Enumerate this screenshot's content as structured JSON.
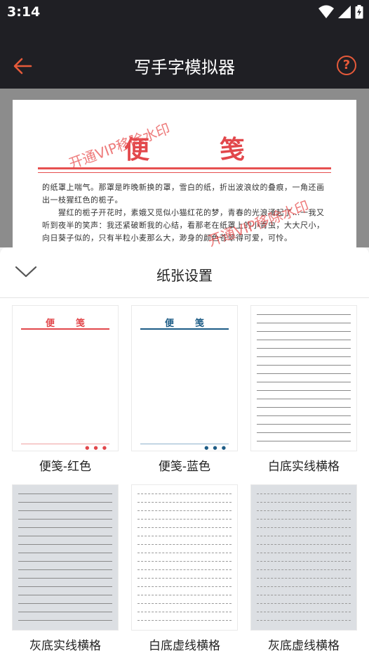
{
  "status": {
    "time": "3:14"
  },
  "app": {
    "title": "写手字模拟器",
    "help_label": "?"
  },
  "preview": {
    "title": "便笺",
    "text": "的纸罩上喘气。那罩是昨晚新换的罩，雪白的纸，折出波浪纹的叠痕，一角还画出一枝猩红色的栀子。\n　　猩红的栀子开花时，素娥又觅似小猫红花的梦，青春的光浪涌起了…一我又听到夜半的笑声：我还紧破断我的心结，看那老在纸罩上的小青虫，大大尺小，向日葵子似的，只有半粒小麦那么大，渺身的颜色苍翠得可爱，可怜。",
    "watermark": "开通VIP移除水印"
  },
  "sheet": {
    "title": "纸张设置"
  },
  "papers": [
    {
      "label": "便笺-红色",
      "mini_title": "便笺",
      "accent": "#e2474b"
    },
    {
      "label": "便笺-蓝色",
      "mini_title": "便笺",
      "accent": "#1d5c86"
    },
    {
      "label": "白底实线横格"
    },
    {
      "label": "灰底实线横格"
    },
    {
      "label": "白底虚线横格"
    },
    {
      "label": "灰底虚线横格"
    }
  ]
}
